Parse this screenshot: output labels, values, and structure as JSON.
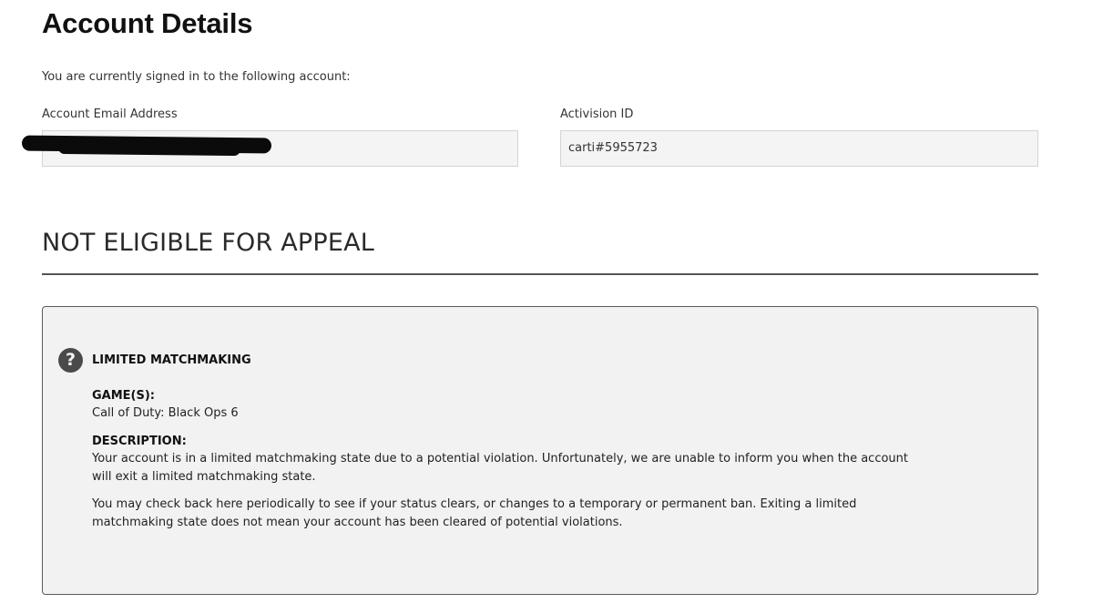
{
  "page": {
    "title": "Account Details",
    "signed_in_text": "You are currently signed in to the following account:"
  },
  "account": {
    "email_label": "Account Email Address",
    "email_value_redacted": "[redacted]",
    "activision_id_label": "Activision ID",
    "activision_id_value": "carti#5955723"
  },
  "appeal": {
    "status_heading": "NOT ELIGIBLE FOR APPEAL"
  },
  "penalty": {
    "icon": "question-circle-icon",
    "title": "LIMITED MATCHMAKING",
    "games_label": "GAME(S):",
    "games_value": "Call of Duty: Black Ops 6",
    "description_label": "DESCRIPTION:",
    "description_p1": "Your account is in a limited matchmaking state due to a potential violation. Unfortunately, we are unable to inform you when the account will exit a limited matchmaking state.",
    "description_p2": "You may check back here periodically to see if your status clears, or changes to a temporary or permanent ban. Exiting a limited matchmaking state does not mean your account has been cleared of potential violations."
  },
  "colors": {
    "field_background": "#f4f4f4",
    "card_background": "#f2f2f2",
    "card_border": "#5a5a5a",
    "divider": "#555555",
    "icon_background": "#4a4a4a"
  }
}
